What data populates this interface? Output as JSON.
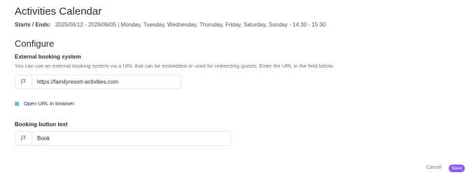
{
  "header": {
    "title": "Activities Calendar",
    "schedule_label": "Starts / Ends:",
    "schedule_value": "2025/06/12 - 2026/06/05 | Monday, Tuesday, Wednesday, Thursday, Friday, Saturday, Sunday - 14:30 - 15:30"
  },
  "configure": {
    "title": "Configure",
    "external_booking": {
      "label": "External booking system",
      "help": "You can use an external booking system via a URL that can be embedded or used for redirecting guests. Enter the URL in the field below.",
      "url_value": "https://familyresort-activities.com",
      "icon": "flag-icon"
    },
    "open_in_browser": {
      "label": "Open URL in browser",
      "checked": true,
      "color": "#5ec4d1"
    },
    "booking_button": {
      "label": "Booking button text",
      "value": "Book",
      "icon": "flag-icon"
    }
  },
  "footer": {
    "cancel_label": "Cancel",
    "save_label": "Save",
    "accent_color": "#8b5cf6"
  }
}
